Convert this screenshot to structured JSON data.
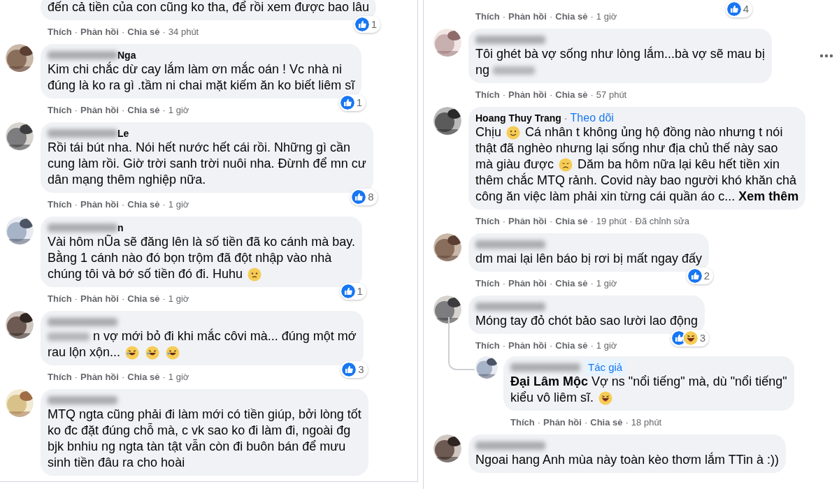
{
  "separator": "·",
  "left_column": {
    "comments": [
      {
        "clipped_top": true,
        "lines": [
          [
            {
              "kind": "text",
              "text": "đến cả tiền của con cũng ko tha, để rồi xem được bao lâu"
            }
          ]
        ],
        "reactions": {
          "icons": [
            {
              "kind": "like"
            }
          ],
          "count": "1"
        },
        "actions": [
          "Thích",
          "Phản hồi",
          "Chia sẻ"
        ],
        "time": "34 phút"
      },
      {
        "name": [
          {
            "kind": "blur"
          },
          {
            "kind": "text",
            "text": "Nga"
          }
        ],
        "lines": [
          [
            {
              "kind": "text",
              "text": "Kim chi chắc dừ cay lắm làm ơn mắc oán ! Vc nhà ni"
            }
          ],
          [
            {
              "kind": "text",
              "text": "đúng là ko ra gì .tầm ni chai mặt kiếm ăn ko biết liêm sĩ"
            }
          ]
        ],
        "reactions": {
          "icons": [
            {
              "kind": "like"
            }
          ],
          "count": "1"
        },
        "actions": [
          "Thích",
          "Phản hồi",
          "Chia sẻ"
        ],
        "time": "1 giờ"
      },
      {
        "name": [
          {
            "kind": "blur"
          },
          {
            "kind": "text",
            "text": "Le"
          }
        ],
        "lines": [
          [
            {
              "kind": "text",
              "text": "Rồi tái bút nha. Nói hết nước hết cái rồi. Những gì cần"
            }
          ],
          [
            {
              "kind": "text",
              "text": "cung làm rồi. Giờ trời sanh trời nuôi nha. Đừnh để mn cư"
            }
          ],
          [
            {
              "kind": "text",
              "text": "dân mạng thêm nghiệp nữa."
            }
          ]
        ],
        "reactions": {
          "icons": [
            {
              "kind": "like"
            }
          ],
          "count": "8"
        },
        "actions": [
          "Thích",
          "Phản hồi",
          "Chia sẻ"
        ],
        "time": "1 giờ"
      },
      {
        "name": [
          {
            "kind": "blur"
          },
          {
            "kind": "text",
            "text": "n"
          }
        ],
        "lines": [
          [
            {
              "kind": "text",
              "text": "Vài hôm nŨa sẽ đăng lên là số tiền đã ko cánh mà bay."
            }
          ],
          [
            {
              "kind": "text",
              "text": "Bằng 1 cánh nào đó bọn trộm đã đột nhập vào nhà"
            }
          ],
          [
            {
              "kind": "text",
              "text": "chúng tôi và bớ số tiền đó đi. Huhu"
            },
            {
              "kind": "worried"
            }
          ]
        ],
        "reactions": {
          "icons": [
            {
              "kind": "like"
            }
          ],
          "count": "1"
        },
        "actions": [
          "Thích",
          "Phản hồi",
          "Chia sẻ"
        ],
        "time": "1 giờ"
      },
      {
        "name": [
          {
            "kind": "blur"
          }
        ],
        "lines": [
          [
            {
              "kind": "blur"
            },
            {
              "kind": "text",
              "text": "n vợ mới bỏ đi khi mắc côvi mà... đúng một mớ"
            }
          ],
          [
            {
              "kind": "text",
              "text": "rau lộn xộn..."
            },
            {
              "kind": "rofl"
            },
            {
              "kind": "rofl"
            },
            {
              "kind": "rofl"
            }
          ]
        ],
        "reactions": {
          "icons": [
            {
              "kind": "like"
            }
          ],
          "count": "3"
        },
        "actions": [
          "Thích",
          "Phản hồi",
          "Chia sẻ"
        ],
        "time": "1 giờ"
      },
      {
        "name": [
          {
            "kind": "blur"
          }
        ],
        "lines": [
          [
            {
              "kind": "text",
              "text": "MTQ ngta cũng phải đi làm mới có tiền giúp, bởi lòng tốt"
            }
          ],
          [
            {
              "kind": "text",
              "text": "ko đc đặt đúng chỗ mà, c vk sao ko đi làm đi, ngoài đg"
            }
          ],
          [
            {
              "kind": "text",
              "text": "bjk bnhiu ng ngta tàn tật vẫn còn đi buôn bán để mưu"
            }
          ],
          [
            {
              "kind": "text",
              "text": "sinh tiền đâu ra cho hoài"
            }
          ]
        ]
      }
    ]
  },
  "right_column": {
    "comments": [
      {
        "clipped_top": true,
        "reactions": {
          "icons": [
            {
              "kind": "like"
            }
          ],
          "count": "4"
        },
        "actions": [
          "Thích",
          "Phản hồi",
          "Chia sẻ"
        ],
        "time": "1 giờ"
      },
      {
        "more_menu": true,
        "name": [
          {
            "kind": "blur"
          }
        ],
        "lines": [
          [
            {
              "kind": "text",
              "text": "Tôi ghét bà vợ sống như lòng lắm...bà vợ sẽ mau bị"
            }
          ],
          [
            {
              "kind": "text",
              "text": "ng"
            },
            {
              "kind": "blur"
            }
          ]
        ],
        "actions": [
          "Thích",
          "Phản hồi",
          "Chia sẻ"
        ],
        "time": "57 phút"
      },
      {
        "name": [
          {
            "kind": "text",
            "text": "Hoang Thuy Trang"
          },
          {
            "kind": "follow",
            "text": "Theo dõi"
          }
        ],
        "lines": [
          [
            {
              "kind": "text",
              "text": "Chịu"
            },
            {
              "kind": "smile"
            },
            {
              "kind": "text",
              "text": "Cá nhân t không ủng hộ đồng nào nhưng t nói"
            }
          ],
          [
            {
              "kind": "text",
              "text": "thật đã nghèo nhưng lại sống như địa chủ thế này sao"
            }
          ],
          [
            {
              "kind": "text",
              "text": "mà giàu được"
            },
            {
              "kind": "sad"
            },
            {
              "kind": "text",
              "text": "Dăm ba hôm nữa lại kêu hết tiền xin"
            }
          ],
          [
            {
              "kind": "text",
              "text": "thêm chắc MTQ rảnh. Covid này bao người khó khăn chả"
            }
          ],
          [
            {
              "kind": "text",
              "text": "công ăn việc làm phải xin từng cái quần áo c..."
            },
            {
              "kind": "more",
              "text": "Xem thêm"
            }
          ]
        ],
        "actions": [
          "Thích",
          "Phản hồi",
          "Chia sẻ"
        ],
        "time": "19 phút",
        "edited": "Đã chỉnh sửa"
      },
      {
        "name": [
          {
            "kind": "blur"
          }
        ],
        "lines": [
          [
            {
              "kind": "text",
              "text": "dm mai lại lên báo bị rơi bị mất ngay đấy"
            }
          ]
        ],
        "reactions": {
          "icons": [
            {
              "kind": "like"
            }
          ],
          "count": "2"
        },
        "actions": [
          "Thích",
          "Phản hồi",
          "Chia sẻ"
        ],
        "time": "1 giờ"
      },
      {
        "name": [
          {
            "kind": "blur"
          }
        ],
        "lines": [
          [
            {
              "kind": "text",
              "text": "Móng tay đỏ chót bảo sao lười lao động"
            }
          ]
        ],
        "reactions": {
          "icons": [
            {
              "kind": "like"
            },
            {
              "kind": "haha"
            }
          ],
          "count": "3"
        },
        "actions": [
          "Thích",
          "Phản hồi",
          "Chia sẻ"
        ],
        "time": "1 giờ",
        "replies": [
          {
            "name": [
              {
                "kind": "blur"
              },
              {
                "kind": "badge",
                "text": "Tác giả"
              }
            ],
            "lines": [
              [
                {
                  "kind": "mention",
                  "text": "Đại Lâm Mộc"
                },
                {
                  "kind": "text",
                  "text": "Vợ ns \"nổi tiếng\" mà, dù \"nổi tiếng\""
                }
              ],
              [
                {
                  "kind": "text",
                  "text": "kiểu vô liêm sĩ."
                },
                {
                  "kind": "haha"
                }
              ]
            ],
            "actions": [
              "Thích",
              "Phản hồi",
              "Chia sẻ"
            ],
            "time": "18 phút"
          }
        ]
      },
      {
        "name": [
          {
            "kind": "blur"
          }
        ],
        "lines": [
          [
            {
              "kind": "text",
              "text": "Ngoai hang Anh mùa này toàn kèo thơm lắm TTin à :))"
            }
          ]
        ]
      }
    ]
  }
}
